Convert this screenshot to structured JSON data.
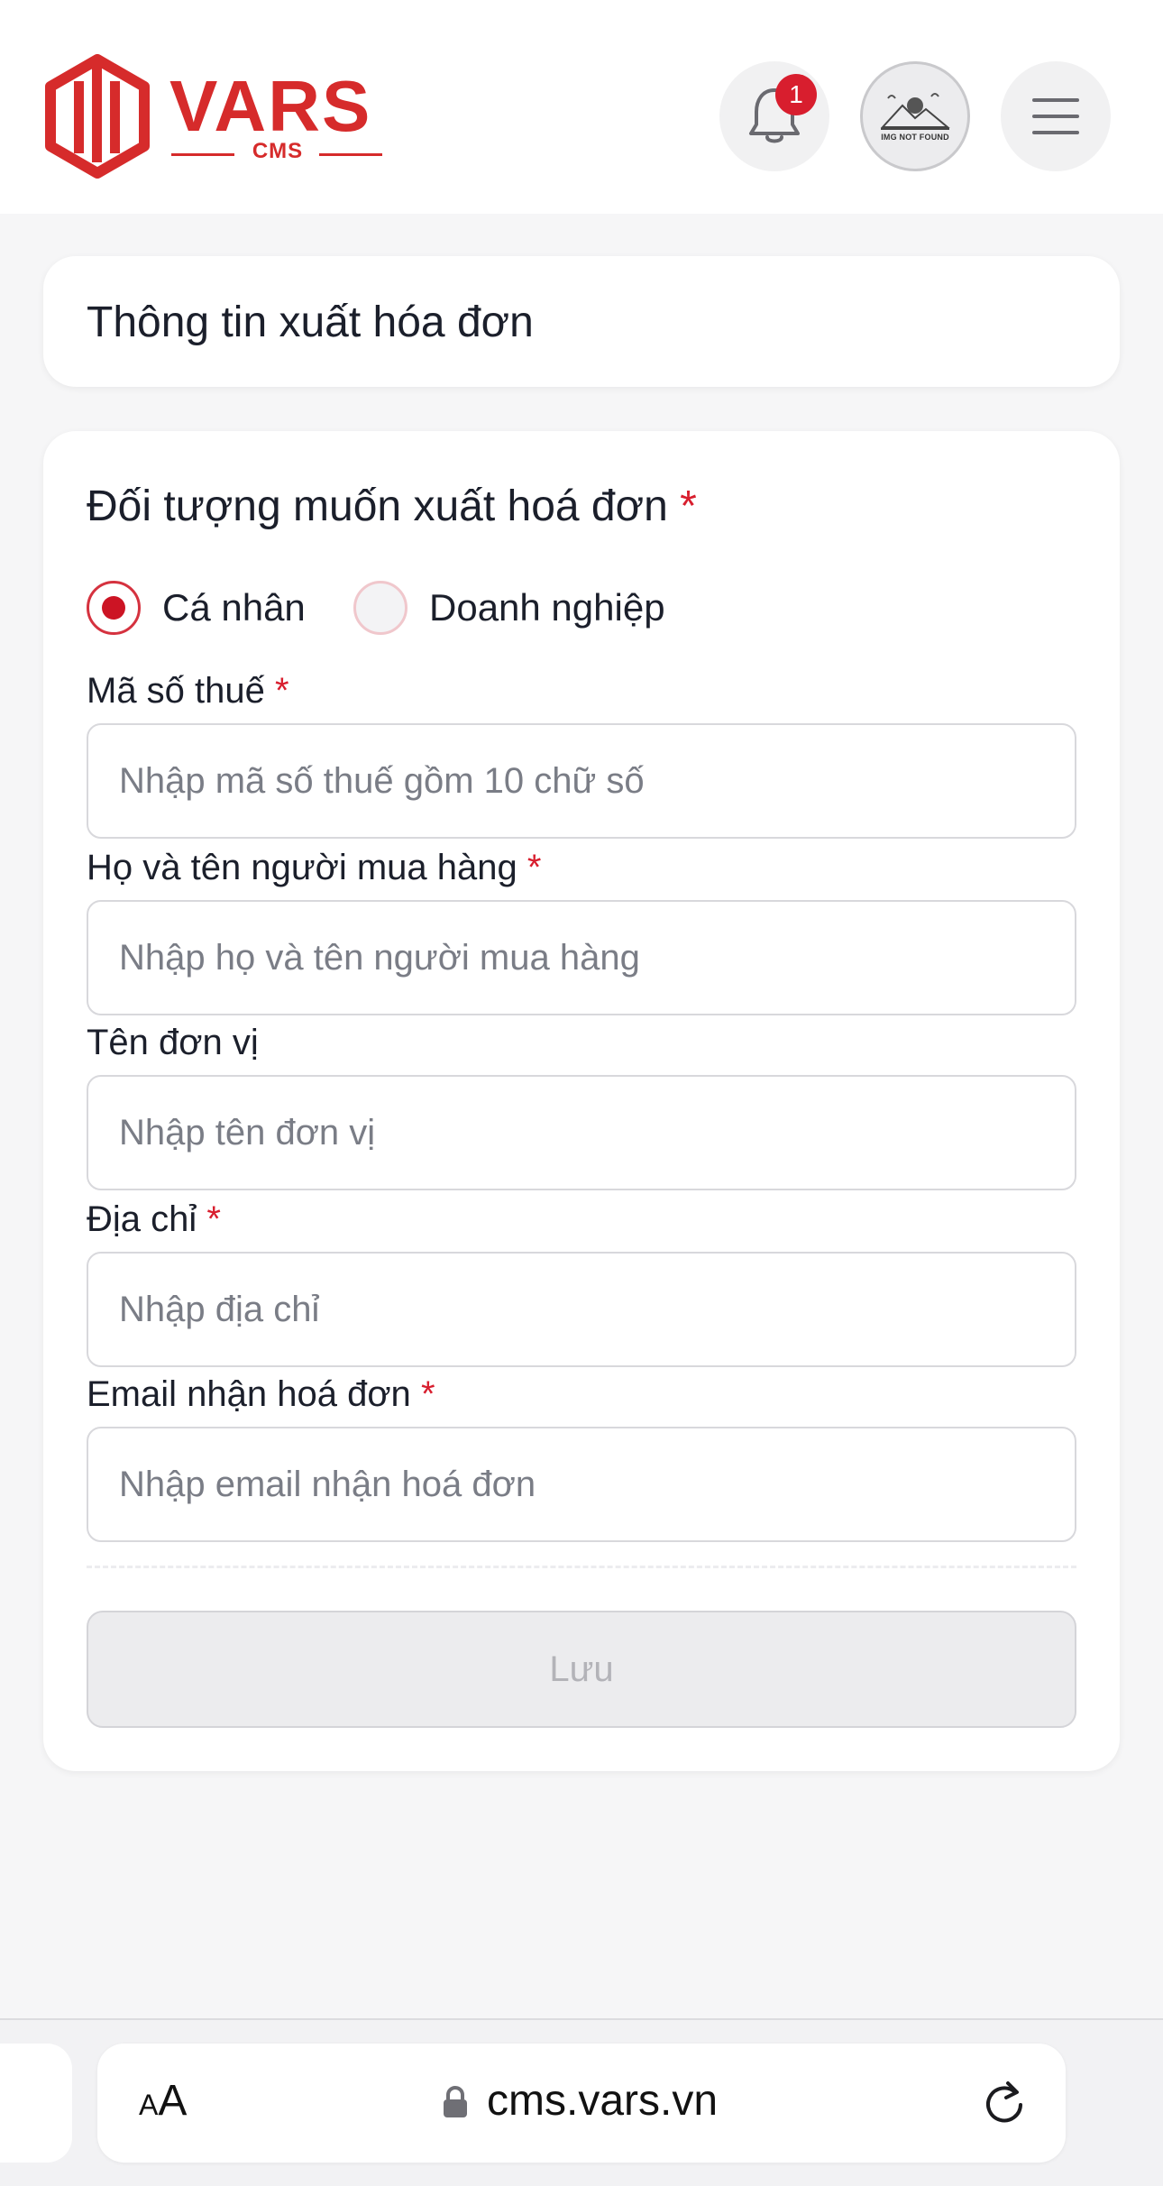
{
  "header": {
    "logo_text": "VARS",
    "logo_sub": "CMS",
    "notification_count": "1",
    "avatar_label": "IMG NOT FOUND",
    "brand_color": "#d62b2b"
  },
  "page_title": "Thông tin xuất hóa đơn",
  "form": {
    "section_title": "Đối tượng muốn xuất hoá đơn",
    "required_mark": "*",
    "radio_options": [
      {
        "label": "Cá nhân",
        "selected": true
      },
      {
        "label": "Doanh nghiệp",
        "selected": false
      }
    ],
    "fields": [
      {
        "label": "Mã số thuế",
        "required": true,
        "placeholder": "Nhập mã số thuế gồm 10 chữ số",
        "value": ""
      },
      {
        "label": "Họ và tên người mua hàng",
        "required": true,
        "placeholder": "Nhập họ và tên người mua hàng",
        "value": ""
      },
      {
        "label": "Tên đơn vị",
        "required": false,
        "placeholder": "Nhập tên đơn vị",
        "value": ""
      },
      {
        "label": "Địa chỉ",
        "required": true,
        "placeholder": "Nhập địa chỉ",
        "value": ""
      },
      {
        "label": "Email nhận hoá đơn",
        "required": true,
        "placeholder": "Nhập email nhận hoá đơn",
        "value": ""
      }
    ],
    "save_label": "Lưu"
  },
  "browser": {
    "text_size_label_small": "A",
    "text_size_label_large": "A",
    "url": "cms.vars.vn"
  },
  "icons": [
    "bell-icon",
    "avatar-image",
    "menu-icon",
    "lock-icon",
    "reload-icon"
  ]
}
